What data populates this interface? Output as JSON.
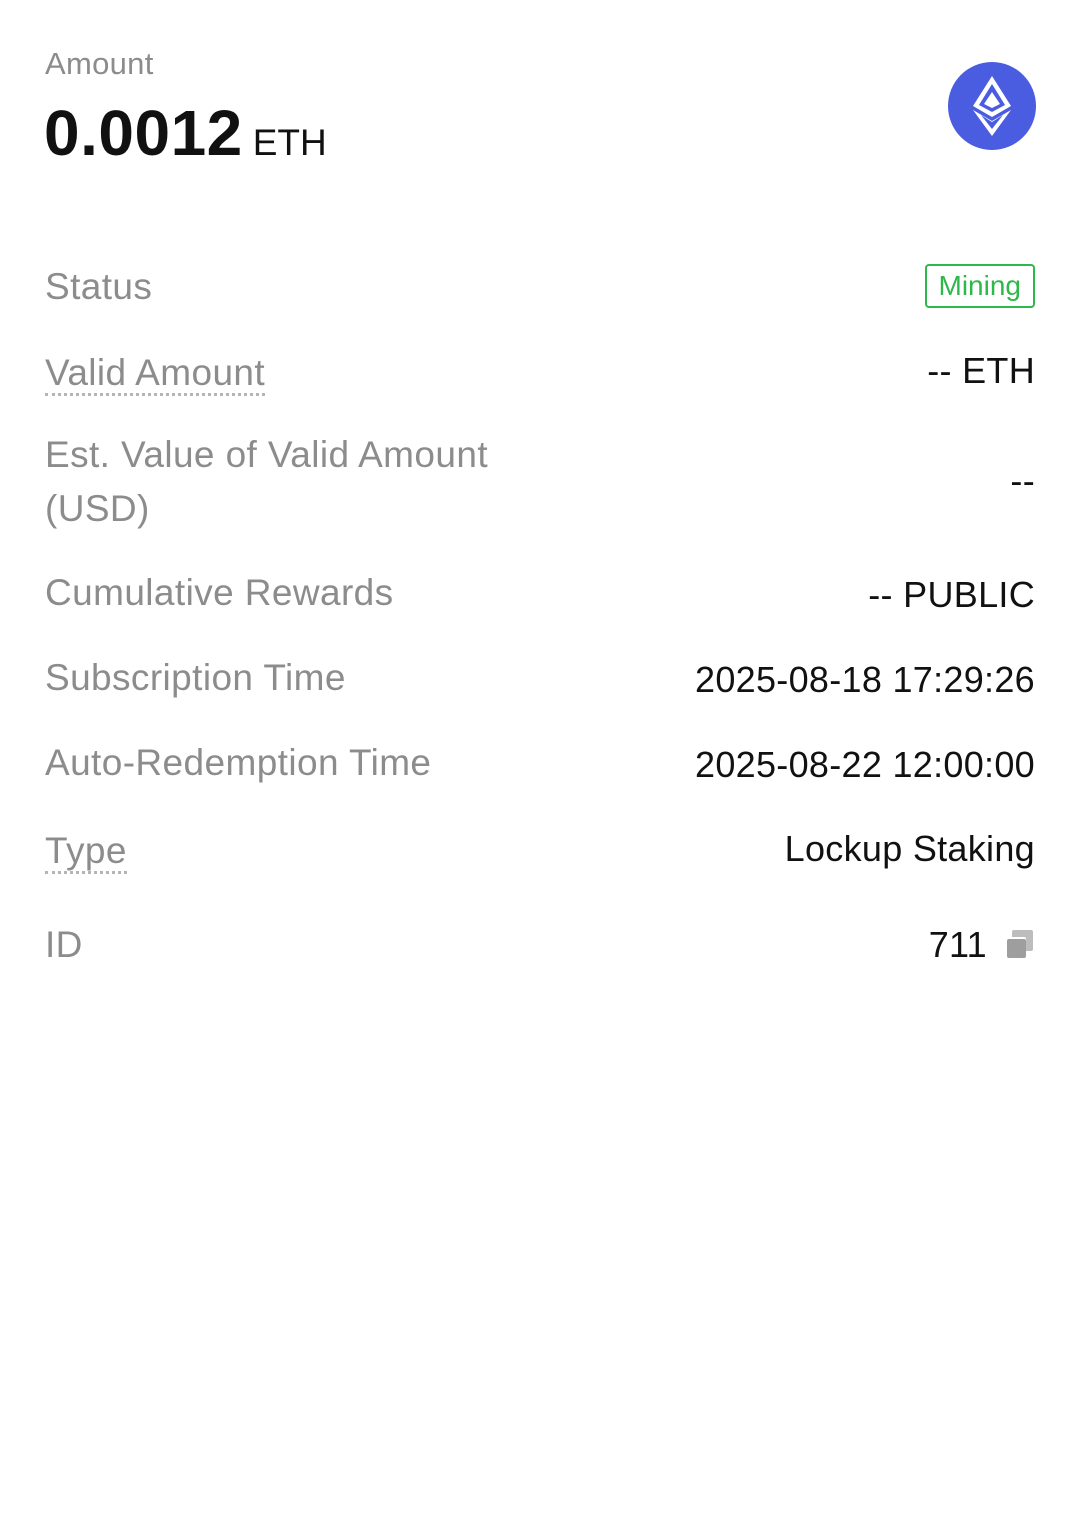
{
  "header": {
    "amount_label": "Amount",
    "amount_value": "0.0012",
    "amount_unit": "ETH",
    "coin_icon": "ethereum-icon",
    "coin_color": "#4a5ce0"
  },
  "details": {
    "status": {
      "label": "Status",
      "value": "Mining",
      "color": "#2fb84a"
    },
    "valid_amount": {
      "label": "Valid Amount",
      "value": "-- ETH"
    },
    "est_value": {
      "label_line1": "Est. Value of Valid Amount",
      "label_line2": "(USD)",
      "value": "--"
    },
    "cumulative_rewards": {
      "label": "Cumulative Rewards",
      "value": "-- PUBLIC"
    },
    "subscription_time": {
      "label": "Subscription Time",
      "value": "2025-08-18 17:29:26"
    },
    "auto_redemption_time": {
      "label": "Auto-Redemption Time",
      "value": "2025-08-22 12:00:00"
    },
    "type": {
      "label": "Type",
      "value": "Lockup Staking"
    },
    "id": {
      "label": "ID",
      "value": "711",
      "icon": "copy-icon"
    }
  }
}
